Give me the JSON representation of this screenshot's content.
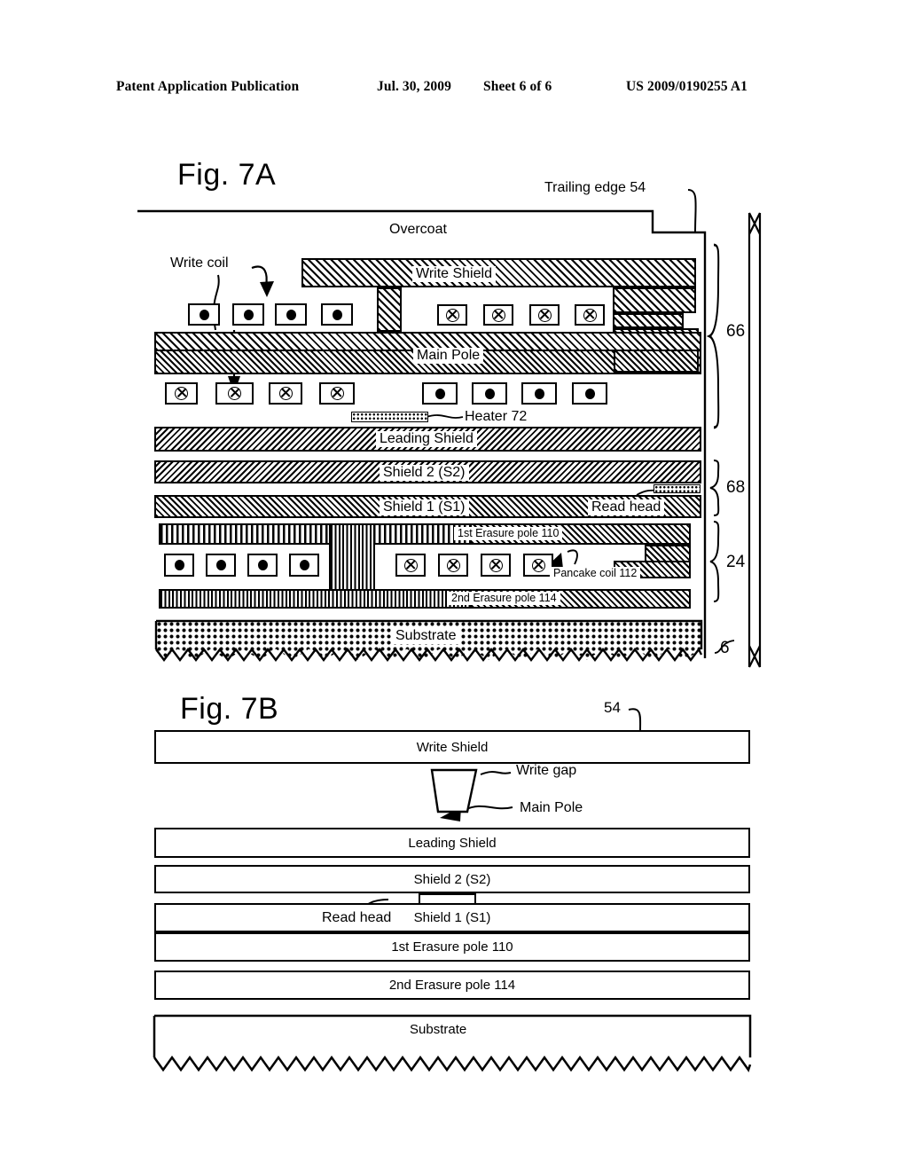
{
  "header": {
    "publication": "Patent Application Publication",
    "date": "Jul. 30, 2009",
    "sheet": "Sheet 6 of 6",
    "number": "US 2009/0190255 A1"
  },
  "fig7a": {
    "label": "Fig. 7A",
    "callouts": {
      "trailing_edge": "Trailing edge 54",
      "write_coil": "Write coil",
      "heater": "Heater 72",
      "pancake_coil": "Pancake coil 112"
    },
    "layers": {
      "overcoat": "Overcoat",
      "write_shield": "Write Shield",
      "main_pole": "Main Pole",
      "leading_shield": "Leading Shield",
      "shield2": "Shield 2 (S2)",
      "shield1": "Shield 1 (S1)",
      "read_head": "Read head",
      "erasure_pole_1": "1st Erasure pole 110",
      "erasure_pole_2": "2nd Erasure pole 114",
      "substrate": "Substrate"
    },
    "brackets": {
      "b66": "66",
      "b68": "68",
      "b24": "24",
      "b6": "6"
    }
  },
  "fig7b": {
    "label": "Fig. 7B",
    "callouts": {
      "trailing_edge_ref": "54",
      "write_gap": "Write gap",
      "main_pole": "Main Pole",
      "read_head": "Read head"
    },
    "bars": [
      {
        "name": "write-shield",
        "label": "Write Shield"
      },
      {
        "name": "leading-shield",
        "label": "Leading Shield"
      },
      {
        "name": "shield2",
        "label": "Shield 2 (S2)"
      },
      {
        "name": "shield1",
        "label": "Shield 1 (S1)"
      },
      {
        "name": "erasure-pole-1",
        "label": "1st Erasure pole 110"
      },
      {
        "name": "erasure-pole-2",
        "label": "2nd Erasure pole 114"
      },
      {
        "name": "substrate",
        "label": "Substrate"
      }
    ]
  }
}
